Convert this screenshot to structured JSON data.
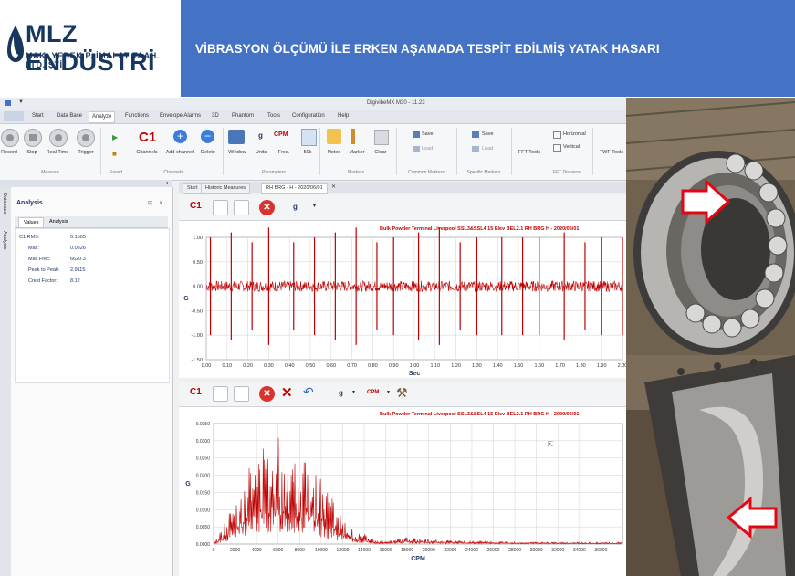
{
  "header": {
    "logo_name": "MLZ ENDÜSTRİ",
    "logo_subtitle": "MAK. YEDEK P. İMALAT TAAH. LTD. ŞTİ.",
    "title": "VİBRASYON ÖLÇÜMÜ İLE ERKEN AŞAMADA TESPİT EDİLMİŞ YATAK HASARI",
    "band_color": "#4472c4",
    "logo_color": "#17375e"
  },
  "app": {
    "window_title": "DigivibeMX M30 - 11.23",
    "menu": [
      "Start",
      "Data Base",
      "Analyze",
      "Functions",
      "Envelope Alarms",
      "3D",
      "Phantom",
      "Tools",
      "Configuration",
      "Help"
    ],
    "ribbon": {
      "measure": {
        "items": [
          "Record",
          "Stop",
          "Real Time",
          "Trigger"
        ],
        "group": "Measure"
      },
      "saved": {
        "group": "Saved"
      },
      "channels": {
        "items": [
          "Channels",
          "Add channel",
          "Delete"
        ],
        "group": "Channels"
      },
      "parameters": {
        "items": [
          "Window",
          "Units",
          "Freq.",
          "50k"
        ],
        "units_value": "g",
        "freq_value": "CPM",
        "group": "Parameters"
      },
      "markers": {
        "items": [
          "Notes",
          "Marker",
          "Clear"
        ],
        "group": "Markers"
      },
      "common_markers": {
        "items": [
          "Save",
          "Load"
        ],
        "group": "Common Markers"
      },
      "specific_markers": {
        "items": [
          "Save",
          "Load"
        ],
        "group": "Specific Markers"
      },
      "fft": {
        "items": [
          "FFT Tools"
        ],
        "group": "FFT Distance"
      },
      "fft_distance": {
        "items": [
          "Horizontal",
          "Vertical"
        ]
      },
      "twf": {
        "items": [
          "TWF Tools"
        ]
      }
    },
    "side_tabs": [
      "Database",
      "Analysis"
    ],
    "analysis_panel": {
      "title": "Analysis",
      "tabs": [
        "Values",
        "Analysis"
      ],
      "rows": [
        {
          "label": "C1 RMS:",
          "value": "0.1505"
        },
        {
          "label": "Max:",
          "value": "0.0326"
        },
        {
          "label": "Max Frec:",
          "value": "6620.3"
        },
        {
          "label": "Peak to Peak:",
          "value": "2.9115"
        },
        {
          "label": "Crest Factor:",
          "value": "8.12"
        }
      ]
    },
    "doc_tabs": [
      "Start",
      "Historic Measures",
      "RH BRG - H - 2020/06/01"
    ],
    "toolbar1": {
      "channel": "C1",
      "unit": "g"
    },
    "toolbar2": {
      "channel": "C1",
      "unit": "g",
      "freq_unit": "CPM"
    }
  },
  "chart_data": [
    {
      "type": "line",
      "title": "Bulk Powder Terminal Liverpool SSL3&SSL4 15 Elev BEL2.1 RH BRG H - 2020/06/01",
      "xlabel": "Sec",
      "ylabel": "G",
      "xlim": [
        0,
        2.0
      ],
      "ylim": [
        -1.5,
        1.0
      ],
      "x_ticks": [
        "0.00",
        "0.10",
        "0.20",
        "0.30",
        "0.40",
        "0.50",
        "0.60",
        "0.70",
        "0.80",
        "0.90",
        "1.00",
        "1.10",
        "1.20",
        "1.30",
        "1.40",
        "1.50",
        "1.60",
        "1.70",
        "1.80",
        "1.90",
        "2.00"
      ],
      "y_ticks": [
        "1.00",
        "0.50",
        "0.00",
        "-0.50",
        "-1.00",
        "-1.50"
      ],
      "impulse_times": [
        0.02,
        0.12,
        0.22,
        0.3,
        0.42,
        0.52,
        0.62,
        0.72,
        0.82,
        0.9,
        1.02,
        1.12,
        1.22,
        1.3,
        1.42,
        1.52,
        1.6,
        1.72,
        1.82,
        1.9,
        2.0
      ],
      "impulse_heights": [
        1.0,
        1.1,
        0.9,
        1.2,
        0.9,
        1.0,
        1.1,
        1.2,
        0.9,
        1.0,
        1.1,
        1.2,
        0.9,
        1.0,
        1.0,
        1.0,
        1.0,
        1.1,
        0.9,
        1.0,
        1.0
      ],
      "color": "#c00000",
      "grid": true
    },
    {
      "type": "line",
      "title": "Bulk Powder Terminal Liverpool SSL3&SSL4 15 Elev BEL2.1 RH BRG H - 2020/06/01",
      "xlabel": "CPM",
      "ylabel": "G",
      "xlim": [
        0,
        38000
      ],
      "ylim": [
        0,
        0.035
      ],
      "x_ticks": [
        "0",
        "2000",
        "4000",
        "6000",
        "8000",
        "10000",
        "12000",
        "14000",
        "16000",
        "18000",
        "20000",
        "22000",
        "24000",
        "26000",
        "28000",
        "30000",
        "32000",
        "34000",
        "36000"
      ],
      "y_ticks": [
        "0.0350",
        "0.0300",
        "0.0250",
        "0.0200",
        "0.0150",
        "0.0100",
        "0.0050",
        "0.0000"
      ],
      "envelope": [
        [
          0,
          0.0
        ],
        [
          1000,
          0.006
        ],
        [
          2000,
          0.014
        ],
        [
          3000,
          0.022
        ],
        [
          4000,
          0.027
        ],
        [
          5000,
          0.03
        ],
        [
          6000,
          0.032
        ],
        [
          7000,
          0.03
        ],
        [
          8000,
          0.029
        ],
        [
          9000,
          0.026
        ],
        [
          10000,
          0.02
        ],
        [
          11000,
          0.014
        ],
        [
          12000,
          0.008
        ],
        [
          13000,
          0.004
        ],
        [
          14000,
          0.003
        ],
        [
          15000,
          0.001
        ],
        [
          16000,
          0.0008
        ],
        [
          18000,
          0.002
        ],
        [
          20000,
          0.0015
        ],
        [
          24000,
          0.0008
        ],
        [
          30000,
          0.0006
        ],
        [
          36000,
          0.0005
        ]
      ],
      "color": "#c00000",
      "grid": true
    }
  ]
}
